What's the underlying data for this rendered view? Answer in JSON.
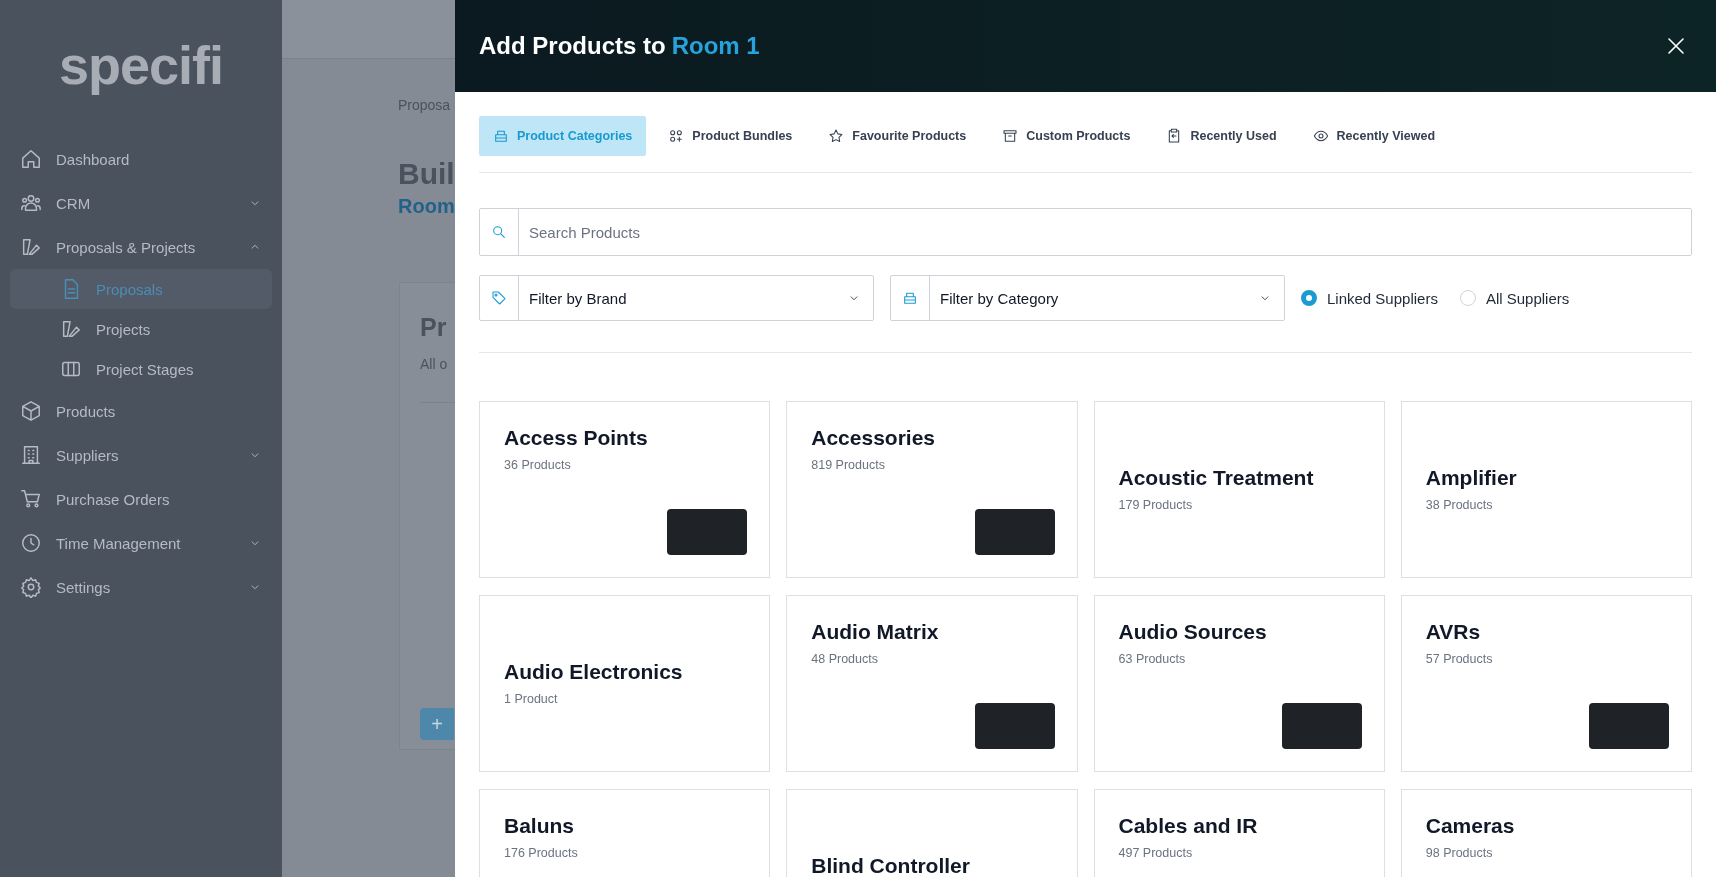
{
  "sidebar": {
    "logo": "specifi",
    "items": [
      {
        "label": "Dashboard"
      },
      {
        "label": "CRM",
        "expanded": false
      },
      {
        "label": "Proposals & Projects",
        "expanded": true,
        "children": [
          {
            "label": "Proposals",
            "selected": true
          },
          {
            "label": "Projects",
            "selected": false
          },
          {
            "label": "Project Stages",
            "selected": false
          }
        ]
      },
      {
        "label": "Products"
      },
      {
        "label": "Suppliers",
        "expanded": false
      },
      {
        "label": "Purchase Orders"
      },
      {
        "label": "Time Management",
        "expanded": false
      },
      {
        "label": "Settings",
        "expanded": false
      }
    ]
  },
  "background_page": {
    "breadcrumb": "Proposa",
    "heading": "Buil",
    "subheading": "Room",
    "card_title": "Pr",
    "card_text": "All o",
    "add_button": "+"
  },
  "modal": {
    "title": "Add Products to",
    "room": "Room 1",
    "tabs": [
      {
        "label": "Product Categories",
        "selected": true
      },
      {
        "label": "Product Bundles",
        "selected": false
      },
      {
        "label": "Favourite Products",
        "selected": false
      },
      {
        "label": "Custom Products",
        "selected": false
      },
      {
        "label": "Recently Used",
        "selected": false
      },
      {
        "label": "Recently Viewed",
        "selected": false
      }
    ],
    "search": {
      "placeholder": "Search Products"
    },
    "brand_filter": {
      "value": "Filter by Brand"
    },
    "category_filter": {
      "value": "Filter by Category"
    },
    "supplier_options": [
      {
        "label": "Linked Suppliers",
        "selected": true
      },
      {
        "label": "All Suppliers",
        "selected": false
      }
    ],
    "categories": [
      {
        "name": "Access Points",
        "count": "36 Products",
        "kind": "top",
        "photo": true
      },
      {
        "name": "Accessories",
        "count": "819 Products",
        "kind": "top",
        "photo": true
      },
      {
        "name": "Acoustic Treatment",
        "count": "179 Products",
        "kind": "middle"
      },
      {
        "name": "Amplifier",
        "count": "38 Products",
        "kind": "middle"
      },
      {
        "name": "Audio Electronics",
        "count": "1 Product",
        "kind": "middle"
      },
      {
        "name": "Audio Matrix",
        "count": "48 Products",
        "kind": "top",
        "photo": true
      },
      {
        "name": "Audio Sources",
        "count": "63 Products",
        "kind": "top",
        "photo": true
      },
      {
        "name": "AVRs",
        "count": "57 Products",
        "kind": "top",
        "photo": true
      },
      {
        "name": "Baluns",
        "count": "176 Products",
        "kind": "top"
      },
      {
        "name": "Blind Controller",
        "kind": "middle"
      },
      {
        "name": "Cables and IR",
        "count": "497 Products",
        "kind": "top"
      },
      {
        "name": "Cameras",
        "count": "98 Products",
        "kind": "top"
      }
    ]
  }
}
